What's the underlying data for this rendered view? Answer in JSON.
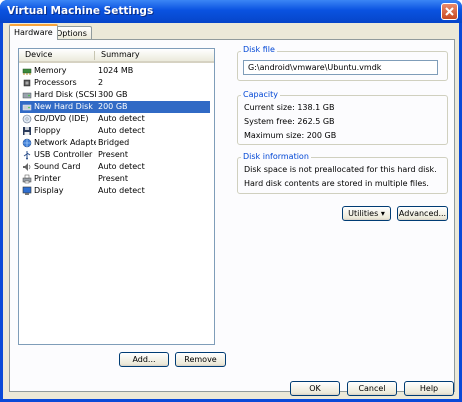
{
  "window": {
    "title": "Virtual Machine Settings"
  },
  "tabs": [
    {
      "label": "Hardware"
    },
    {
      "label": "Options"
    }
  ],
  "device_list": {
    "columns": {
      "device": "Device",
      "summary": "Summary"
    },
    "rows": [
      {
        "device": "Memory",
        "summary": "1024 MB",
        "icon": "memory-icon"
      },
      {
        "device": "Processors",
        "summary": "2",
        "icon": "processor-icon"
      },
      {
        "device": "Hard Disk (SCSI)",
        "summary": "300 GB",
        "icon": "hard-disk-icon"
      },
      {
        "device": "New Hard Disk ...",
        "summary": "200 GB",
        "icon": "hard-disk-icon"
      },
      {
        "device": "CD/DVD (IDE)",
        "summary": "Auto detect",
        "icon": "cd-dvd-icon"
      },
      {
        "device": "Floppy",
        "summary": "Auto detect",
        "icon": "floppy-icon"
      },
      {
        "device": "Network Adapter",
        "summary": "Bridged",
        "icon": "network-adapter-icon"
      },
      {
        "device": "USB Controller",
        "summary": "Present",
        "icon": "usb-icon"
      },
      {
        "device": "Sound Card",
        "summary": "Auto detect",
        "icon": "sound-card-icon"
      },
      {
        "device": "Printer",
        "summary": "Present",
        "icon": "printer-icon"
      },
      {
        "device": "Display",
        "summary": "Auto detect",
        "icon": "display-icon"
      }
    ],
    "selected_index": 3
  },
  "buttons": {
    "add": "Add...",
    "remove": "Remove",
    "utilities": "Utilities",
    "advanced": "Advanced...",
    "ok": "OK",
    "cancel": "Cancel",
    "help": "Help"
  },
  "disk_file": {
    "label": "Disk file",
    "value": "G:\\android\\vmware\\Ubuntu.vmdk"
  },
  "capacity": {
    "label": "Capacity",
    "current_size": "Current size: 138.1 GB",
    "system_free": "System free: 262.5 GB",
    "maximum_size": "Maximum size: 200 GB"
  },
  "disk_information": {
    "label": "Disk information",
    "line1": "Disk space is not preallocated for this hard disk.",
    "line2": "Hard disk contents are stored in multiple files."
  },
  "colors": {
    "selection": "#316ac5",
    "title_bar": "#0a52e0",
    "group_label": "#0046d5"
  }
}
